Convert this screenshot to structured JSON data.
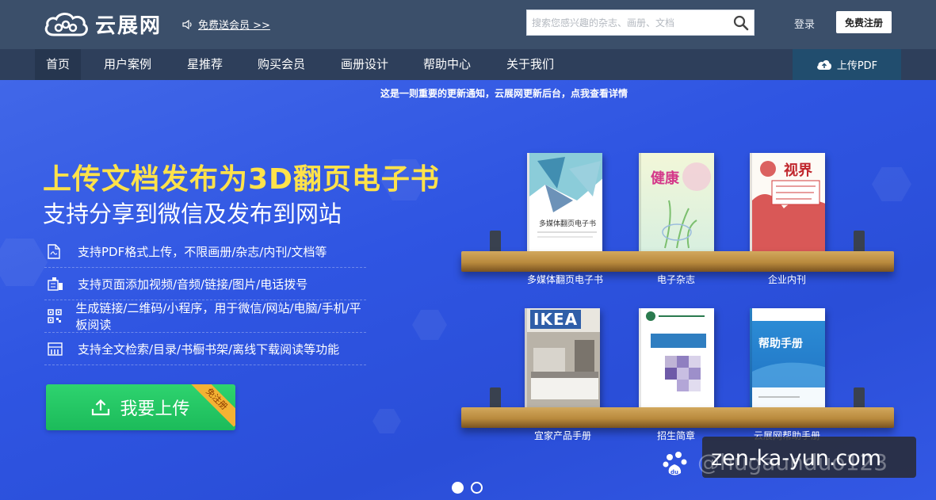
{
  "header": {
    "logo_text": "云展网",
    "notice_link": "免费送会员 >>",
    "search_placeholder": "搜索您感兴趣的杂志、画册、文档",
    "login": "登录",
    "register": "免费注册"
  },
  "nav": {
    "items": [
      {
        "label": "首页"
      },
      {
        "label": "用户案例"
      },
      {
        "label": "星推荐"
      },
      {
        "label": "购买会员"
      },
      {
        "label": "画册设计"
      },
      {
        "label": "帮助中心"
      },
      {
        "label": "关于我们"
      }
    ],
    "upload_pdf": "上传PDF"
  },
  "hero": {
    "announcement": "这是一则重要的更新通知，云展网更新后台，点我查看详情",
    "headline": "上传文档发布为3D翻页电子书",
    "subheadline": "支持分享到微信及发布到网站",
    "features": [
      {
        "icon": "pdf-file-icon",
        "text": "支持PDF格式上传，不限画册/杂志/内刊/文档等"
      },
      {
        "icon": "media-icon",
        "text": "支持页面添加视频/音频/链接/图片/电话拨号"
      },
      {
        "icon": "qrcode-icon",
        "text": "生成链接/二维码/小程序，用于微信/网站/电脑/手机/平板阅读"
      },
      {
        "icon": "bookshelf-icon",
        "text": "支持全文检索/目录/书橱书架/离线下载阅读等功能"
      }
    ],
    "upload_button": "我要上传",
    "ribbon": "免注册"
  },
  "shelves": {
    "top": [
      {
        "label": "多媒体翻页电子书",
        "cover_title": "多媒体翻页电子书"
      },
      {
        "label": "电子杂志",
        "cover_title": "健康"
      },
      {
        "label": "企业内刊",
        "cover_title": "视界"
      }
    ],
    "bottom": [
      {
        "label": "宜家产品手册",
        "cover_title": "IKEA"
      },
      {
        "label": "招生简章",
        "cover_title": ""
      },
      {
        "label": "云展网帮助手册",
        "cover_title": "帮助手册"
      }
    ]
  },
  "watermark": {
    "site": "zen-ka-yun.com",
    "user": "@hugaunduo123"
  },
  "colors": {
    "topbar": "#3b4f6a",
    "navbar": "#2e3f5b",
    "hero_blue": "#2f55e2",
    "headline_yellow": "#ffe24a",
    "upload_green": "#22c462",
    "ribbon_orange": "#f4b233"
  }
}
